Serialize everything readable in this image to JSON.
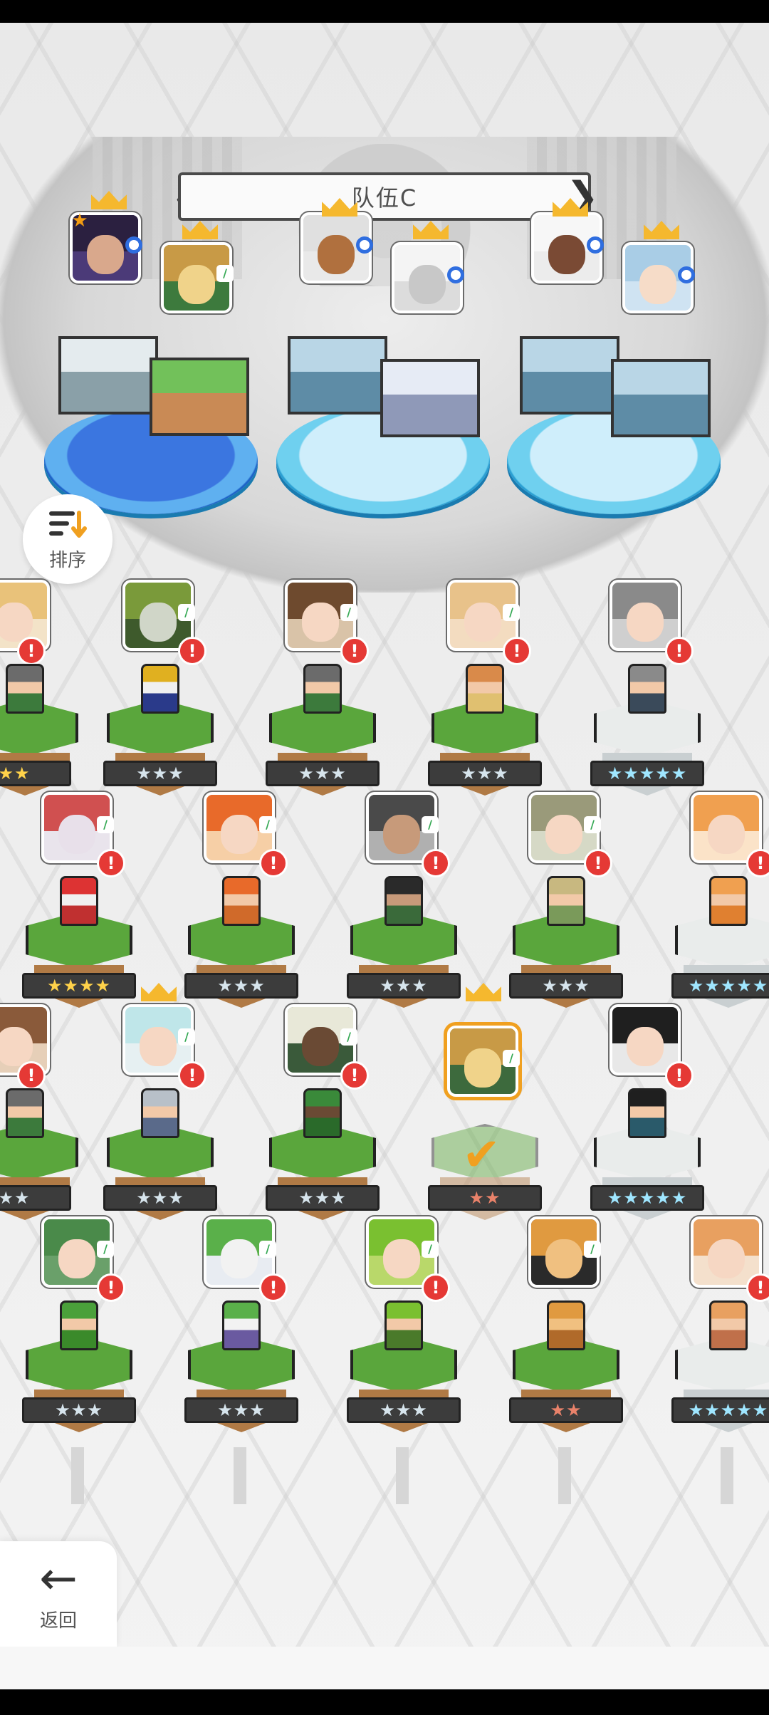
{
  "team": {
    "title": "队伍C",
    "prev_symbol": "❮",
    "next_symbol": "❯"
  },
  "sort": {
    "label": "排序"
  },
  "back": {
    "label": "返回",
    "arrow": "←"
  },
  "colors": {
    "accent": "#f0a020",
    "alert": "#e53935",
    "team_badge": "#2f6ee0",
    "pad_blue": "#2a9ed2"
  },
  "rarities": {
    "r2": "★★",
    "r3": "★★★",
    "r4": "★★★★",
    "r5": "★★★★★"
  },
  "alert_symbol": "!",
  "check_symbol": "✔",
  "leaf_symbol": "/",
  "star_symbol": "★",
  "roster": [
    {
      "row": 1,
      "rarity": "r2"
    },
    {
      "row": 1,
      "rarity": "r3"
    },
    {
      "row": 1,
      "rarity": "r3"
    },
    {
      "row": 1,
      "rarity": "r3"
    },
    {
      "row": 1,
      "rarity": "r5"
    },
    {
      "row": 2,
      "rarity": "r4"
    },
    {
      "row": 2,
      "rarity": "r3"
    },
    {
      "row": 2,
      "rarity": "r3"
    },
    {
      "row": 2,
      "rarity": "r3"
    },
    {
      "row": 2,
      "rarity": "r5"
    },
    {
      "row": 3,
      "rarity": "r2"
    },
    {
      "row": 3,
      "rarity": "r3"
    },
    {
      "row": 3,
      "rarity": "r3"
    },
    {
      "row": 3,
      "rarity": "r2"
    },
    {
      "row": 3,
      "rarity": "r5"
    },
    {
      "row": 4,
      "rarity": "r3"
    },
    {
      "row": 4,
      "rarity": "r3"
    },
    {
      "row": 4,
      "rarity": "r3"
    },
    {
      "row": 4,
      "rarity": "r2"
    },
    {
      "row": 4,
      "rarity": "r5"
    }
  ]
}
